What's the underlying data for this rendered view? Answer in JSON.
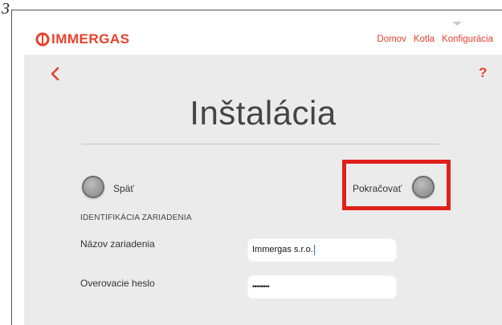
{
  "page_number": "3",
  "header": {
    "logo_text": "IMMERGAS",
    "nav": [
      "Domov",
      "Kotla",
      "Konfigurácia"
    ]
  },
  "toolbar": {
    "back_icon": "chevron-left-icon",
    "help_label": "?"
  },
  "title": "Inštalácia",
  "actions": {
    "back_label": "Späť",
    "continue_label": "Pokračovať"
  },
  "section_title": "IDENTIFIKÁCIA ZARIADENIA",
  "form": {
    "device_name_label": "Názov zariadenia",
    "device_name_value": "Immergas s.r.o.",
    "password_label": "Overovacie heslo",
    "password_value": "••••••••"
  },
  "colors": {
    "brand": "#e8412c",
    "highlight": "#e0201b",
    "background": "#ebebeb"
  }
}
